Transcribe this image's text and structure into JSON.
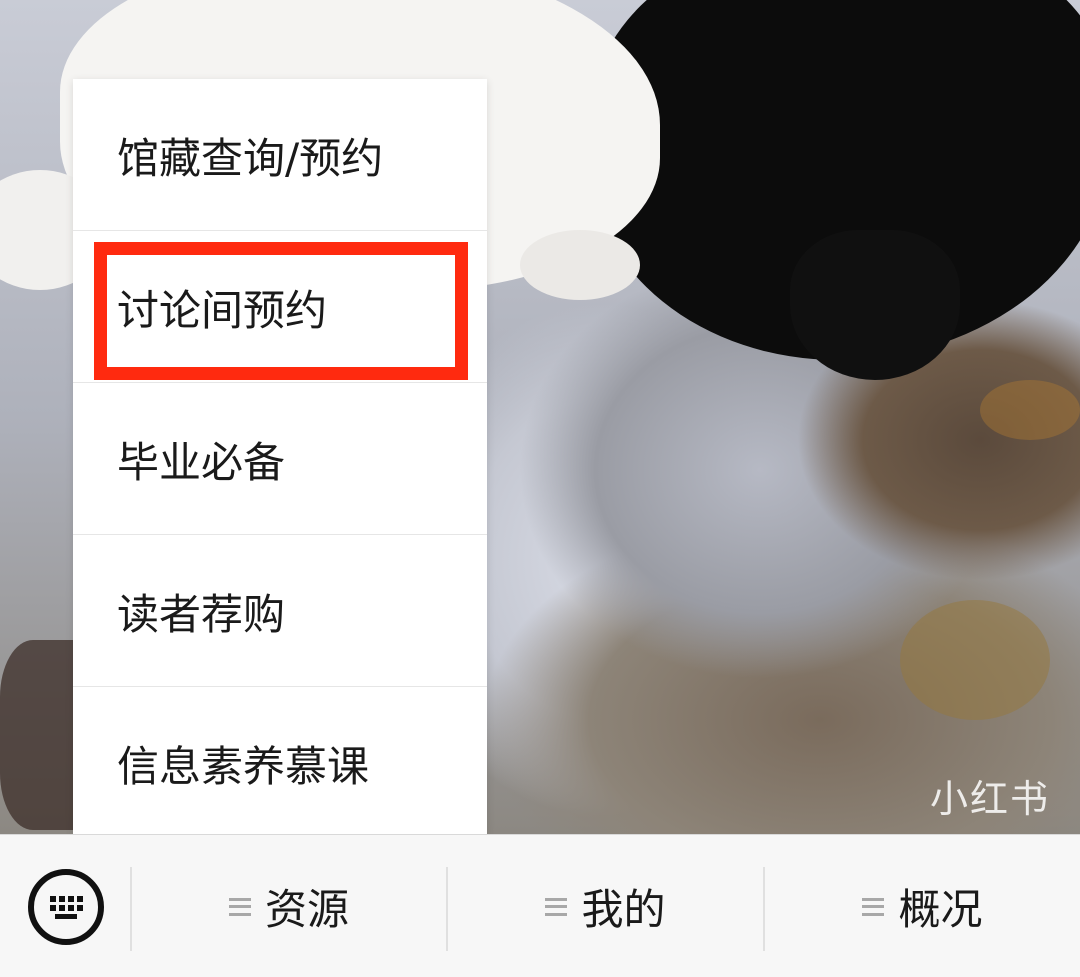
{
  "background": {
    "watermark": "小红书"
  },
  "menu": {
    "items": [
      {
        "label": "馆藏查询/预约"
      },
      {
        "label": "讨论间预约"
      },
      {
        "label": "毕业必备"
      },
      {
        "label": "读者荐购"
      },
      {
        "label": "信息素养慕课"
      }
    ],
    "highlighted_index": 1,
    "highlight_color": "#ff2a0f"
  },
  "bottom_bar": {
    "keyboard_icon": "keyboard-icon",
    "tabs": [
      {
        "label": "资源",
        "icon": "menu-lines-icon"
      },
      {
        "label": "我的",
        "icon": "menu-lines-icon"
      },
      {
        "label": "概况",
        "icon": "menu-lines-icon"
      }
    ]
  }
}
